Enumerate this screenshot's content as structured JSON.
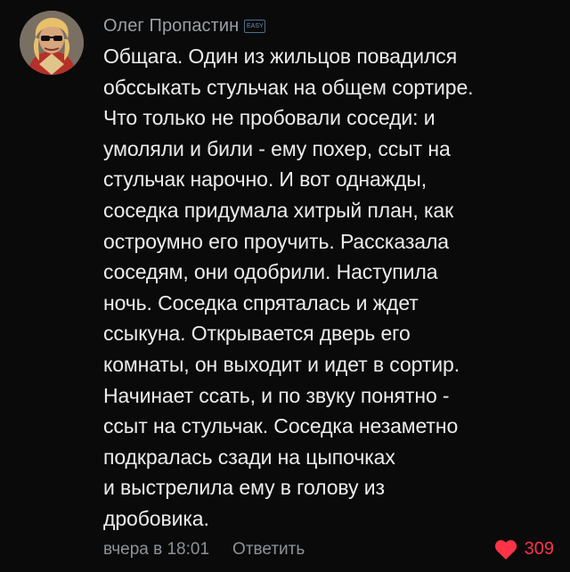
{
  "comment": {
    "author": "Олег Пропастин",
    "badge_text": "EASY",
    "lines": [
      "Общага. Один из жильцов повадился",
      "обссыкать стульчак на общем сортире.",
      "Что только не пробовали соседи: и",
      "умоляли и били - ему похер, ссыт на",
      "стульчак нарочно. И вот однажды,",
      "соседка придумала хитрый план, как",
      "остроумно его проучить. Рассказала",
      "соседям, они одобрили. Наступила",
      "ночь. Соседка спряталась и ждет",
      "ссыкуна. Открывается дверь его",
      "комнаты, он выходит и идет в сортир.",
      "Начинает ссать, и по звуку понятно -",
      "ссыт на стульчак. Соседка незаметно",
      "подкралась сзади на цыпочках",
      "и выстрелила ему в голову из",
      "дробовика."
    ],
    "timestamp": "вчера в 18:01",
    "reply_label": "Ответить",
    "like_count": "309",
    "liked": true,
    "avatar_icon": "user-avatar-icon",
    "like_icon": "heart-icon",
    "colors": {
      "background": "#0a0a0a",
      "text": "#ececec",
      "muted": "#8d9299",
      "like": "#ff3347"
    }
  }
}
